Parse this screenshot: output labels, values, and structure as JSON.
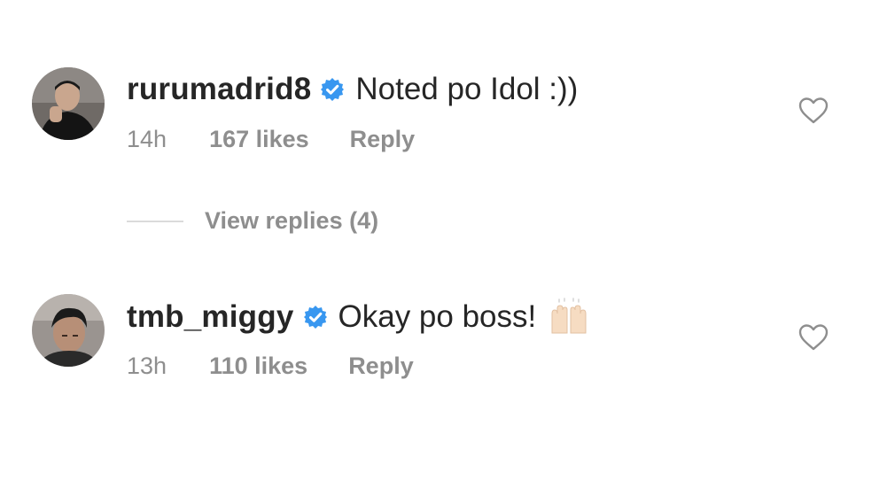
{
  "comments": [
    {
      "username": "rurumadrid8",
      "verified": true,
      "text": "Noted po Idol :))",
      "time": "14h",
      "likes": "167 likes",
      "reply_label": "Reply"
    },
    {
      "username": "tmb_miggy",
      "verified": true,
      "text": "Okay po boss!",
      "emoji": "raising-hands-icon",
      "time": "13h",
      "likes": "110 likes",
      "reply_label": "Reply"
    }
  ],
  "view_replies": {
    "label": "View replies (4)"
  },
  "colors": {
    "primary_text": "#262626",
    "secondary_text": "#8e8e8e",
    "verified_blue": "#3897f0",
    "divider": "#dbdbdb"
  }
}
